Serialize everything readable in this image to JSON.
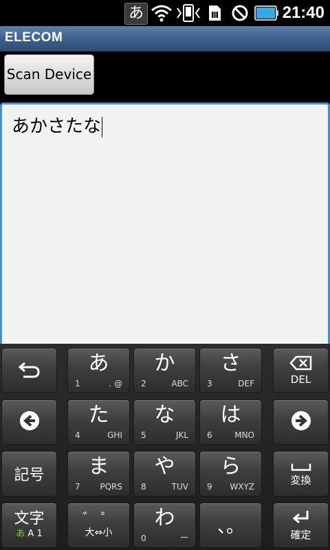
{
  "statusbar": {
    "ime_indicator": "あ",
    "icons": [
      "wifi-icon",
      "usb-debug-icon",
      "sim-card-icon",
      "blocked-icon",
      "battery-icon"
    ],
    "time": "21:40"
  },
  "app": {
    "title": "ELECOM",
    "scan_button_label": "Scan Device"
  },
  "editor": {
    "value": "あかさたな"
  },
  "keyboard": {
    "undo": "undo",
    "del_label": "DEL",
    "henkan_label": "変換",
    "kakutei_label": "確定",
    "kigou_label": "記号",
    "moji_label": "文字",
    "moji_sub_kana": "あ",
    "moji_sub_rest": "A 1",
    "dakuten_label": "゛ ゜",
    "daishou_label": "大⇔小",
    "punct_label": "、。",
    "keys": [
      {
        "main": "あ",
        "num": "1",
        "txt": ". @"
      },
      {
        "main": "か",
        "num": "2",
        "txt": "ABC"
      },
      {
        "main": "さ",
        "num": "3",
        "txt": "DEF"
      },
      {
        "main": "た",
        "num": "4",
        "txt": "GHI"
      },
      {
        "main": "な",
        "num": "5",
        "txt": "JKL"
      },
      {
        "main": "は",
        "num": "6",
        "txt": "MNO"
      },
      {
        "main": "ま",
        "num": "7",
        "txt": "PQRS"
      },
      {
        "main": "や",
        "num": "8",
        "txt": "TUV"
      },
      {
        "main": "ら",
        "num": "9",
        "txt": "WXYZ"
      },
      {
        "main": "わ",
        "num": "0",
        "txt": "ー"
      }
    ],
    "colors": {
      "accent": "#3f8fd6",
      "kana_indicator": "#7cd12f"
    }
  }
}
